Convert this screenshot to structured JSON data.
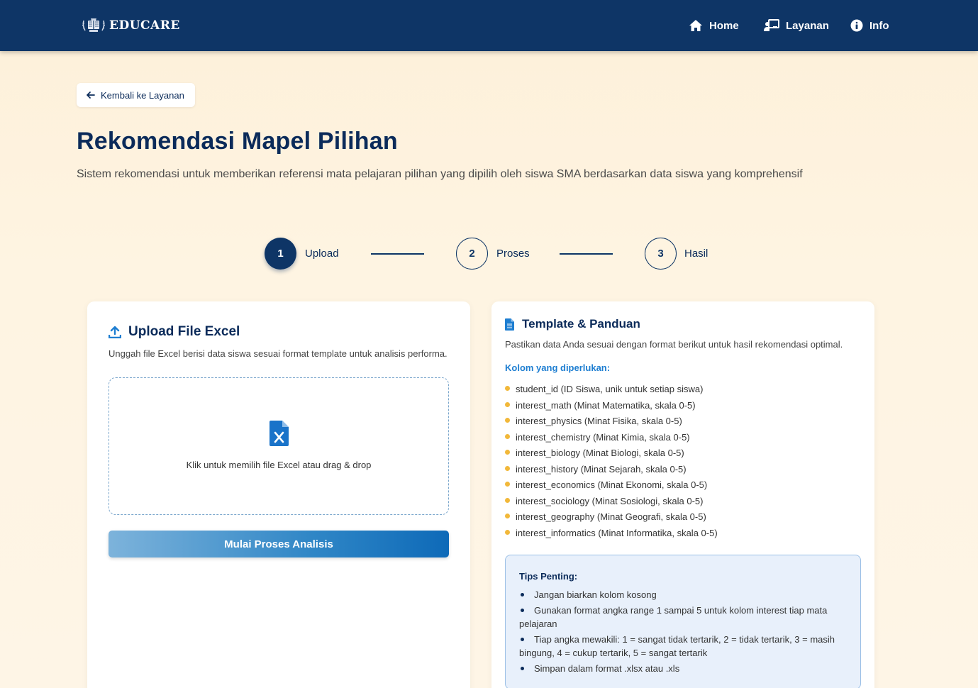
{
  "navbar": {
    "brand": "EDUCARE",
    "items": [
      {
        "label": "Home",
        "icon": "home-icon"
      },
      {
        "label": "Layanan",
        "icon": "chalkboard-teacher-icon"
      },
      {
        "label": "Info",
        "icon": "info-circle-icon"
      }
    ]
  },
  "back_button": {
    "label": "Kembali ke Layanan",
    "icon": "arrow-left-icon"
  },
  "page": {
    "title": "Rekomendasi Mapel Pilihan",
    "description": "Sistem rekomendasi untuk memberikan referensi mata pelajaran pilihan yang dipilih oleh siswa SMA berdasarkan data siswa yang komprehensif"
  },
  "stepper": {
    "steps": [
      {
        "number": "1",
        "label": "Upload",
        "active": true
      },
      {
        "number": "2",
        "label": "Proses",
        "active": false
      },
      {
        "number": "3",
        "label": "Hasil",
        "active": false
      }
    ]
  },
  "upload": {
    "title": "Upload File Excel",
    "description": "Unggah file Excel berisi data siswa sesuai format template untuk analisis performa.",
    "dropzone_text": "Klik untuk memilih file Excel atau drag & drop",
    "start_button": "Mulai Proses Analisis"
  },
  "template": {
    "title": "Template & Panduan",
    "description": "Pastikan data Anda sesuai dengan format berikut untuk hasil rekomendasi optimal.",
    "columns_heading": "Kolom yang diperlukan:",
    "columns": [
      "student_id (ID Siswa, unik untuk setiap siswa)",
      "interest_math (Minat Matematika, skala 0-5)",
      "interest_physics (Minat Fisika, skala 0-5)",
      "interest_chemistry (Minat Kimia, skala 0-5)",
      "interest_biology (Minat Biologi, skala 0-5)",
      "interest_history (Minat Sejarah, skala 0-5)",
      "interest_economics (Minat Ekonomi, skala 0-5)",
      "interest_sociology (Minat Sosiologi, skala 0-5)",
      "interest_geography (Minat Geografi, skala 0-5)",
      "interest_informatics (Minat Informatika, skala 0-5)"
    ],
    "tips_title": "Tips Penting:",
    "tips": [
      "Jangan biarkan kolom kosong",
      "Gunakan format angka range 1 sampai 5 untuk kolom interest tiap mata pelajaran",
      "Tiap angka mewakili: 1 = sangat tidak tertarik, 2 = tidak tertarik, 3 = masih bingung, 4 = cukup tertarik, 5 = sangat tertarik",
      "Simpan dalam format .xlsx atau .xls"
    ]
  },
  "colors": {
    "navy": "#0e3566",
    "accent_blue": "#1e7ed1",
    "bullet_yellow": "#f2b83a",
    "excel_icon": "#1a73c9"
  }
}
